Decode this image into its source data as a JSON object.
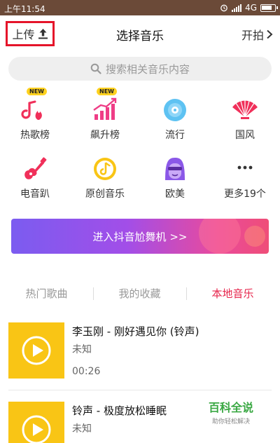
{
  "status_bar": {
    "time": "上午11:54",
    "network": "4G"
  },
  "header": {
    "upload_label": "上传",
    "title": "选择音乐",
    "shoot_label": "开拍"
  },
  "search": {
    "placeholder": "搜索相关音乐内容"
  },
  "categories": [
    {
      "label": "热歌榜",
      "badge": "NEW",
      "icon": "hot-chart-icon"
    },
    {
      "label": "飙升榜",
      "badge": "NEW",
      "icon": "rising-chart-icon"
    },
    {
      "label": "流行",
      "icon": "cd-disc-icon"
    },
    {
      "label": "国风",
      "icon": "folding-fan-icon"
    },
    {
      "label": "电音趴",
      "icon": "electric-guitar-icon"
    },
    {
      "label": "原创音乐",
      "icon": "music-note-icon"
    },
    {
      "label": "欧美",
      "icon": "avatar-purple-hair-icon"
    },
    {
      "label": "更多19个",
      "icon": "more-dots-icon"
    }
  ],
  "banner": {
    "label": "进入抖音尬舞机 >>"
  },
  "tabs": [
    {
      "label": "热门歌曲",
      "active": false
    },
    {
      "label": "我的收藏",
      "active": false
    },
    {
      "label": "本地音乐",
      "active": true
    }
  ],
  "songs": [
    {
      "title": "李玉刚 - 刚好遇见你 (铃声)",
      "artist": "未知",
      "duration": "00:26"
    },
    {
      "title": "铃声 - 极度放松睡眠",
      "artist": "未知",
      "duration": ""
    }
  ],
  "watermark": {
    "main": "百科全说",
    "sub": "助你轻松解决"
  },
  "colors": {
    "accent": "#e6234a",
    "highlight_box": "#e5142a",
    "thumb": "#f9c515",
    "status_bar": "#6b4a38"
  }
}
